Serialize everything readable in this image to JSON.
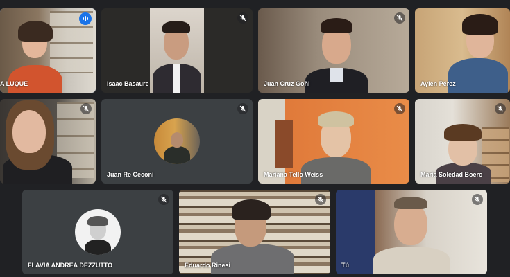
{
  "participants": [
    {
      "name": "A LUQUE",
      "muted": false,
      "speaking": true
    },
    {
      "name": "Isaac Basaure",
      "muted": true
    },
    {
      "name": "Juan Cruz Goñi",
      "muted": true
    },
    {
      "name": "Aylen Pérez",
      "muted": true
    },
    {
      "name": "",
      "muted": true
    },
    {
      "name": "Juan Re Ceconi",
      "muted": true
    },
    {
      "name": "Mariana Tello Weiss",
      "muted": true
    },
    {
      "name": "María Soledad Boero",
      "muted": true
    },
    {
      "name": "FLAVIA ANDREA DEZZUTTO",
      "muted": true
    },
    {
      "name": "Eduardo Rinesi",
      "muted": true
    },
    {
      "name": "Tú",
      "muted": true
    }
  ],
  "colors": {
    "background": "#202124",
    "tile": "#3c4043",
    "active_outline": "#8ab4f8",
    "speaking": "#1a73e8"
  },
  "icons": {
    "muted": "mic-off-icon",
    "speaking": "audio-level-icon"
  }
}
